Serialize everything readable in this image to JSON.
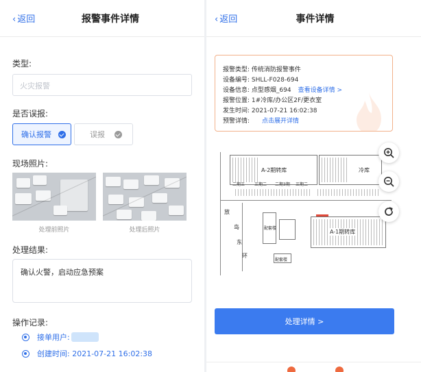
{
  "left": {
    "back_label": "返回",
    "title": "报警事件详情",
    "type_label": "类型:",
    "type_placeholder": "火灾报警",
    "false_alarm_label": "是否误报:",
    "confirm_option": "确认报警",
    "false_option": "误报",
    "photos_label": "现场照片:",
    "photo_before_caption": "处理前照片",
    "photo_after_caption": "处理后照片",
    "result_label": "处理结果:",
    "result_text": "确认火警，启动应急预案",
    "log_label": "操作记录:",
    "log_items": [
      {
        "text": "接单用户:"
      },
      {
        "text": "创建时间: 2021-07-21 16:02:38"
      }
    ]
  },
  "right": {
    "back_label": "返回",
    "title": "事件详情",
    "info": {
      "type_key": "报警类型:",
      "type_value": "传统消防报警事件",
      "code_key": "设备编号:",
      "code_value": "SHLL-F028-694",
      "device_key": "设备信息:",
      "device_value": "点型感烟_694",
      "device_link": "查看设备详情 >",
      "location_key": "报警位置:",
      "location_value": "1#冷库/办公区2F/更衣室",
      "time_key": "发生时间:",
      "time_value": "2021-07-21 16:02:38",
      "detail_key": "预警详情:",
      "detail_link": "点击展开详情"
    },
    "map": {
      "building_a2": "A-2期转库",
      "building_cold": "冷库",
      "building_a1": "A-1期转库",
      "area_1": "二期三",
      "area_2": "三期二",
      "area_3": "二期3期",
      "area_4": "三期二",
      "road_1": "放",
      "road_2": "岛",
      "road_3": "东",
      "road_4": "环",
      "small_1": "配套楼",
      "small_2": "配套楼"
    },
    "zoom_in_icon": "zoom-in-icon",
    "zoom_out_icon": "zoom-out-icon",
    "refresh_icon": "refresh-icon",
    "action_button": "处理详情 >"
  },
  "colors": {
    "accent": "#2f6fe8",
    "button": "#3b7bef",
    "card_border": "#f2b18a",
    "alarm_marker": "#e0493a"
  }
}
